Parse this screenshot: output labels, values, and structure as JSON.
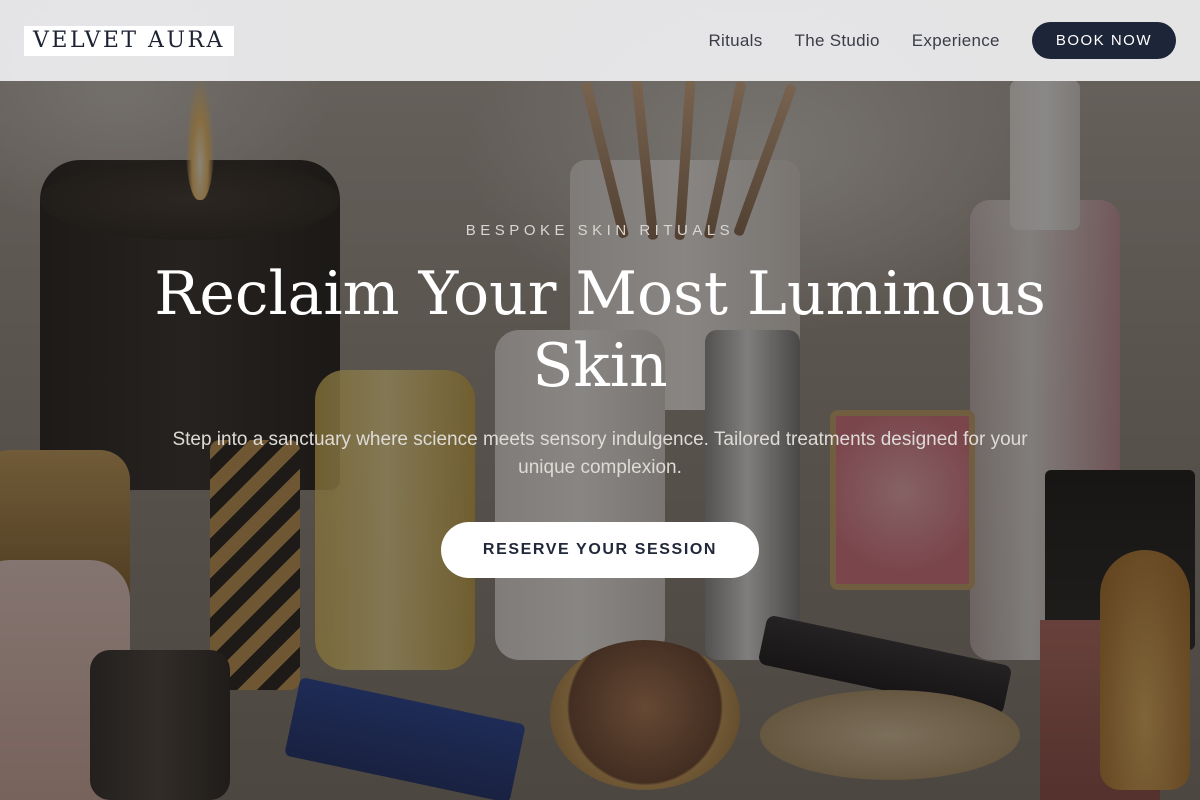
{
  "header": {
    "logo": "VELVET AURA",
    "nav": [
      {
        "label": "Rituals"
      },
      {
        "label": "The Studio"
      },
      {
        "label": "Experience"
      }
    ],
    "cta_label": "BOOK NOW"
  },
  "hero": {
    "eyebrow": "BESPOKE SKIN RITUALS",
    "headline": "Reclaim Your Most Luminous Skin",
    "subtext": "Step into a sanctuary where science meets sensory indulgence. Tailored treatments designed for your unique complexion.",
    "cta_label": "RESERVE YOUR SESSION",
    "background_image": "cosmetics-vanity-photo"
  },
  "colors": {
    "header_bg": "#eeeef0",
    "brand_navy": "#1d2538",
    "text_light": "#ffffff"
  }
}
